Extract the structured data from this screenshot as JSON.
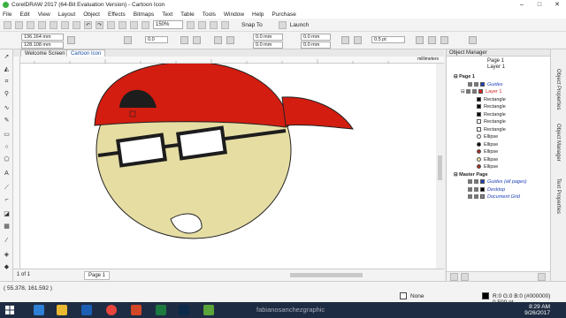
{
  "window": {
    "title": "CorelDRAW 2017 (64-Bit Evaluation Version) - Cartoon Icon"
  },
  "menu": [
    "File",
    "Edit",
    "View",
    "Layout",
    "Object",
    "Effects",
    "Bitmaps",
    "Text",
    "Table",
    "Tools",
    "Window",
    "Help",
    "Purchase"
  ],
  "toolbar": {
    "zoom": "150%",
    "snap_label": "Snap To",
    "launch_label": "Launch"
  },
  "propbar": {
    "x": "136.164 mm",
    "y": "128.108 mm",
    "angle": "0.0",
    "pos1": "0.0 mm",
    "pos2": "0.0 mm",
    "pos3": "0.0 mm",
    "pos4": "0.0 mm",
    "outline_width": "0.5 pt"
  },
  "doc_tabs": [
    "Welcome Screen",
    "Cartoon Icon"
  ],
  "ruler_unit": "millimeters",
  "navigation": {
    "page_of": "1 of 1",
    "page_tab": "Page 1"
  },
  "object_manager": {
    "title": "Object Manager",
    "crumb_page": "Page 1",
    "crumb_layer": "Layer 1",
    "rows": [
      {
        "label": "Page 1",
        "kind": "page"
      },
      {
        "label": "Guides",
        "kind": "guides",
        "color": "#1c3fb5"
      },
      {
        "label": "Layer 1",
        "kind": "layer",
        "color": "#d11f1f"
      },
      {
        "label": "Rectangle",
        "kind": "shape",
        "color": "#000000"
      },
      {
        "label": "Rectangle",
        "kind": "shape",
        "color": "#000000"
      },
      {
        "label": "Rectangle",
        "kind": "shape",
        "color": "#000000"
      },
      {
        "label": "Rectangle",
        "kind": "shape",
        "color": "#ffffff"
      },
      {
        "label": "Rectangle",
        "kind": "shape",
        "color": "#ffffff"
      },
      {
        "label": "Ellipse",
        "kind": "shape",
        "color": "#ffffff"
      },
      {
        "label": "Ellipse",
        "kind": "shape",
        "color": "#000000"
      },
      {
        "label": "Ellipse",
        "kind": "shape",
        "color": "#a52a1f"
      },
      {
        "label": "Ellipse",
        "kind": "shape",
        "color": "#e8dfa4"
      },
      {
        "label": "Ellipse",
        "kind": "shape",
        "color": "#a52a1f"
      },
      {
        "label": "Master Page",
        "kind": "page"
      },
      {
        "label": "Guides (all pages)",
        "kind": "guides",
        "color": "#1c3fb5"
      },
      {
        "label": "Desktop",
        "kind": "guides",
        "color": "#000000"
      },
      {
        "label": "Document Grid",
        "kind": "guides",
        "color": "#888888"
      }
    ]
  },
  "docker_tabs": [
    "Object Properties",
    "Object Manager",
    "Text Properties"
  ],
  "status": {
    "coords": "( 55.378, 161.592 )",
    "fill": "None",
    "outline": "R:0 G:0 B:0 (#000000)  0.500 pt"
  },
  "taskbar": {
    "time": "8:29 AM",
    "date": "9/26/2017",
    "watermark": "fabianosanchezgraphic"
  },
  "colors": {
    "cap": "#d21d10",
    "face": "#e6dda3",
    "dark": "#1d1d1d"
  }
}
